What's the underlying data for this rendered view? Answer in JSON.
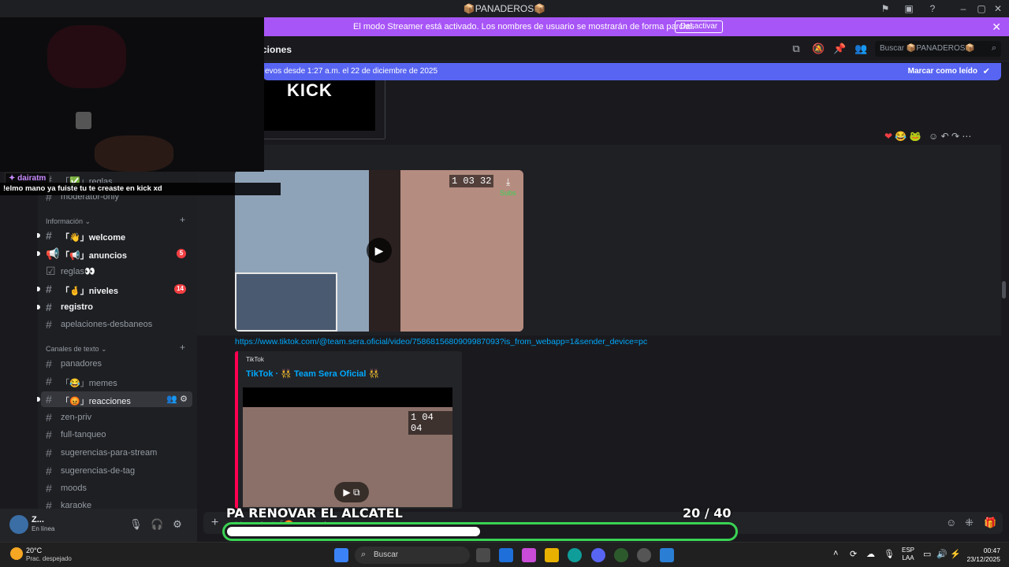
{
  "window": {
    "title": "📦PANADEROS📦"
  },
  "streamer_banner": {
    "message": "El modo Streamer está activado. Los nombres de usuario se mostrarán de forma parcial.",
    "button": "Desactivar"
  },
  "channel_header": {
    "name": "ciones",
    "search_placeholder": "Buscar 📦PANADEROS📦"
  },
  "new_messages": {
    "text": "evos desde 1:27 a.m. el 22 de diciembre de 2025",
    "mark_read": "Marcar como leído"
  },
  "sidebar": {
    "top_items": [
      {
        "label": "「✅」reglas"
      },
      {
        "label": "moderator-only"
      }
    ],
    "categories": [
      {
        "label": "Información ⌄"
      },
      {
        "label": "Canales de texto ⌄"
      }
    ],
    "info_items": [
      {
        "label": "「👋」welcome",
        "unread": true
      },
      {
        "label": "「📢」anuncios",
        "unread": true,
        "badge": "5"
      },
      {
        "label": "reglas👀",
        "unread": false
      },
      {
        "label": "「🤞」niveles",
        "unread": true,
        "badge": "14"
      },
      {
        "label": "registro",
        "unread": true
      },
      {
        "label": "apelaciones-desbaneos",
        "unread": false
      }
    ],
    "text_items": [
      {
        "label": "panadores"
      },
      {
        "label": "「😂」memes"
      },
      {
        "label": "「😡」reacciones",
        "active": true
      },
      {
        "label": "zen-priv"
      },
      {
        "label": "full-tanqueo"
      },
      {
        "label": "sugerencias-para-stream"
      },
      {
        "label": "sugerencias-de-tag"
      },
      {
        "label": "moods"
      },
      {
        "label": "karaoke"
      }
    ]
  },
  "user_panel": {
    "name": "Z...",
    "status": "En línea"
  },
  "chat": {
    "kick_image_text": "KICK",
    "video1": {
      "days": "1",
      "hours": "03",
      "minutes": "32",
      "subs_label": "Subs"
    },
    "link": "https://www.tiktok.com/@team.sera.oficial/video/7586815680909987093?is_from_webapp=1&sender_device=pc",
    "embed": {
      "provider": "TikTok",
      "author": "TikTok · 👯 Team Sera Oficial 👯",
      "video_days": "1",
      "video_hours": "04",
      "video_minutes": "04"
    },
    "input_placeholder": "Mensaje #「😡」reacciones"
  },
  "stream_overlay": {
    "chat_user": "dairatm",
    "chat_message": "!elmo mano ya fuiste tu te creaste en kick xd",
    "goal_label": "PA RENOVAR EL ALCATEL",
    "goal_current": "20",
    "goal_total": "/ 40",
    "goal_fraction": 0.5
  },
  "taskbar": {
    "weather_temp": "20°C",
    "weather_desc": "Prac. despejado",
    "search": "Buscar",
    "lang": "ESP",
    "lang2": "LAA",
    "time": "00:47",
    "date": "23/12/2025"
  },
  "colors": {
    "banner": "#a855f7",
    "new_messages": "#5865f2",
    "goal_border": "#39d353",
    "mention_badge": "#f23f43"
  }
}
